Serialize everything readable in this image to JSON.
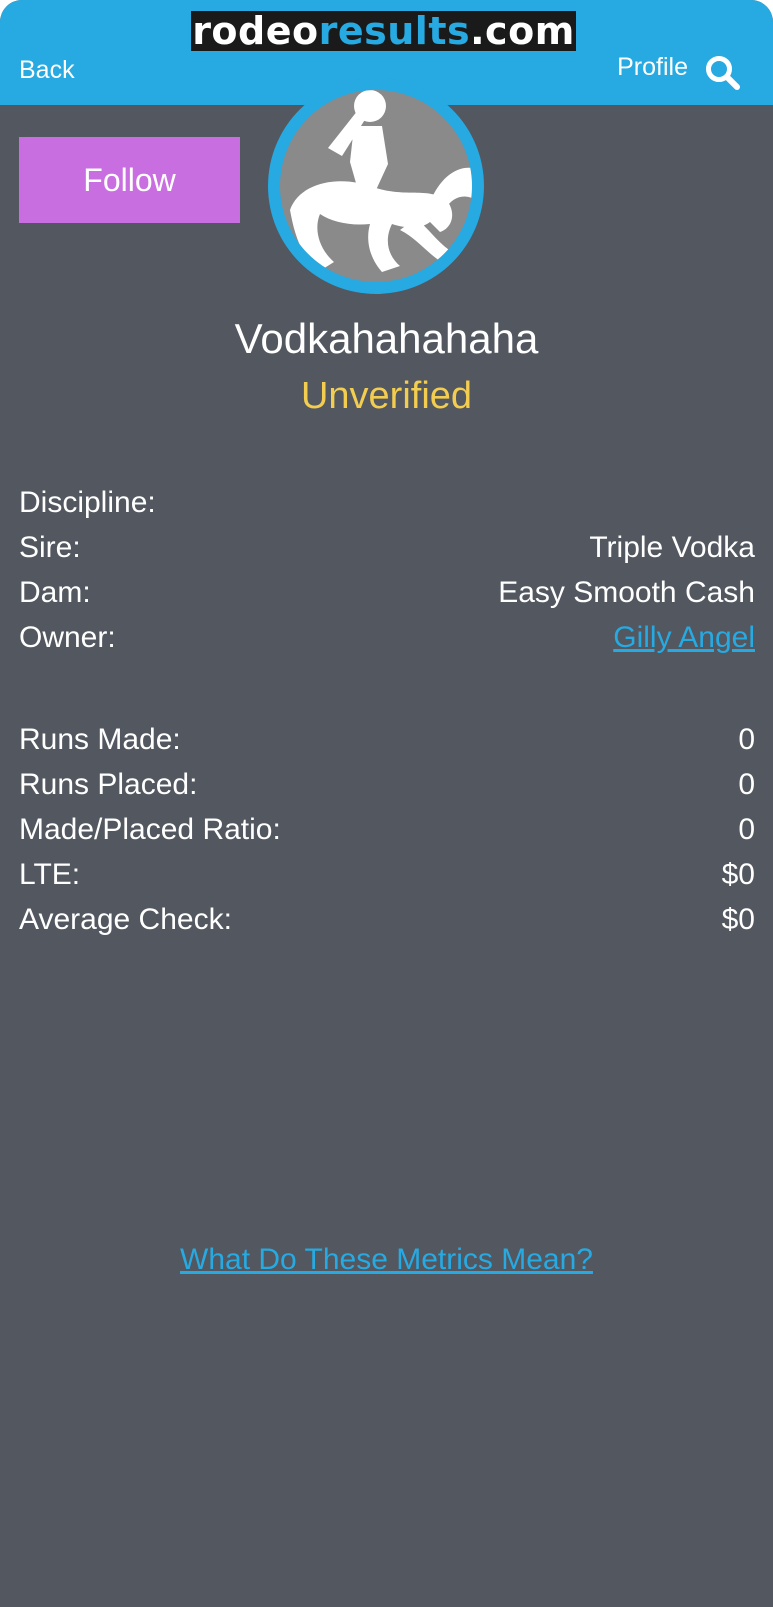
{
  "header": {
    "logo": {
      "part1": "rodeo",
      "part2": "results",
      "part3": ".com"
    },
    "back_label": "Back",
    "profile_label": "Profile",
    "search_icon": "search-icon"
  },
  "profile": {
    "follow_label": "Follow",
    "avatar_icon": "bronc-rider-icon",
    "name": "Vodkahahahaha",
    "status": "Unverified",
    "status_color": "#f2cd4f"
  },
  "details": [
    {
      "label": "Discipline:",
      "value": ""
    },
    {
      "label": "Sire:",
      "value": "Triple Vodka"
    },
    {
      "label": "Dam:",
      "value": "Easy Smooth Cash"
    },
    {
      "label": "Owner:",
      "value": "Gilly Angel"
    }
  ],
  "stats": [
    {
      "label": "Runs Made:",
      "value": "0"
    },
    {
      "label": "Runs Placed:",
      "value": "0"
    },
    {
      "label": "Made/Placed Ratio:",
      "value": "0"
    },
    {
      "label": "LTE:",
      "value": "$0"
    },
    {
      "label": "Average Check:",
      "value": "$0"
    }
  ],
  "metrics_link": "What Do These Metrics Mean?",
  "colors": {
    "accent": "#27a9e1",
    "background": "#525760",
    "follow_button": "#c96ee0"
  }
}
